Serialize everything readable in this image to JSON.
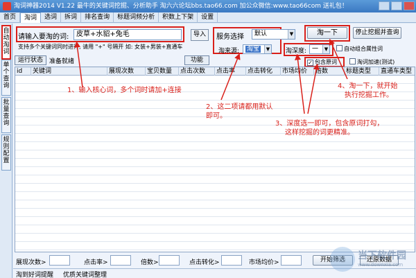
{
  "window": {
    "title": "淘词神器2014 V1.22 最牛的关键词挖掘、分析助手 淘六六论坛bbs.tao66.com 加公众微信:www.tao66com 送礼包！"
  },
  "tabs": [
    "首页",
    "淘词",
    "选词",
    "拆词",
    "排名查询",
    "标题词频分析",
    "积数上下架",
    "设置"
  ],
  "side_tabs": [
    "自动淘词",
    "单个查询",
    "批量查询",
    "规则配置"
  ],
  "keyword_input": {
    "label": "请输入要淘的词:",
    "value": "皮草+水貂+兔毛",
    "import_label": "导入",
    "hint": "支持多个关键词同时进行, 请用 \"+\" 号隔开 如: 女装+男装+直通车"
  },
  "service": {
    "label": "服务选择",
    "value": "默认",
    "source_label": "淘来源:",
    "source_value": "淘宝",
    "depth_label": "淘深度:",
    "depth_value": "一"
  },
  "buttons": {
    "search": "淘一下",
    "stop": "停止挖掘并查询",
    "status": "运行状态",
    "function": "功能"
  },
  "checkboxes": {
    "auto_combine": "自动组合属性词",
    "include_original": "包含原词",
    "accelerate": "淘词加速(测试)"
  },
  "status_text": "准备就绪",
  "columns": [
    "id",
    "关键词",
    "展现次数",
    "宝贝数量",
    "点击次数",
    "点击率",
    "点击转化",
    "市场均价",
    "倍数",
    "标题类型",
    "直通车类型"
  ],
  "annotations": [
    "1、输入核心词，多个词时请加+连接",
    "2、这二项请都用默认",
    "即可。",
    "3、深度选一即可，包含原词打勾，",
    "这样挖掘的词更精准。",
    "4、淘一下，就开始",
    "执行挖掘工作。"
  ],
  "filters": {
    "impressions": "展现次数>",
    "ctr": "点击率>",
    "multiple": "倍数>",
    "conversion": "点击转化>",
    "avg_price": "市场均价>",
    "start_filter": "开始筛选",
    "restore": "还原数据"
  },
  "bottom_tabs": [
    "淘到好词提醒",
    "优质关键词整理"
  ],
  "watermark": {
    "text": "当下软件园",
    "url": "www.downxia.com"
  }
}
